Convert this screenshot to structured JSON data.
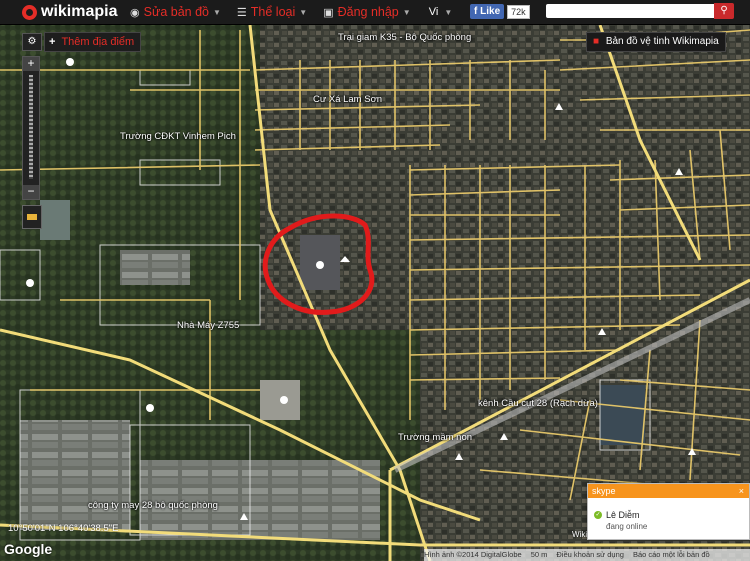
{
  "topbar": {
    "logo": "wikimapia",
    "menu": [
      {
        "icon": "globe-icon",
        "label": "Sửa bản đồ"
      },
      {
        "icon": "categories-icon",
        "label": "Thể loại"
      },
      {
        "icon": "login-icon",
        "label": "Đăng nhập"
      }
    ],
    "language": "Vi",
    "facebook": {
      "like_label": "Like",
      "count": "72k"
    },
    "search": {
      "placeholder": ""
    }
  },
  "controls": {
    "add_place": "Thêm địa điểm",
    "satellite_map": "Bản đồ vệ tinh Wikimapia"
  },
  "map_labels": [
    "Trại giam K35 - Bộ Quốc phòng",
    "Cư Xá Lam Sơn",
    "Trường CĐKT Vinhem Pich",
    "Nhà Máy Z755",
    "kênh Cầu cụt 28 (Rạch dừa)",
    "Trường mầm non",
    "công ty may 28 bộ quốc phòng"
  ],
  "coordinates": "10°50'01\"N 106°40'38.5\"E",
  "attribution": {
    "wikimapia": "Wikimapia CC BY-SA",
    "imagery": "Hình ảnh ©2014 DigitalGlobe",
    "scale": "50 m",
    "terms": "Điều khoản sử dụng",
    "report": "Báo cáo một lỗi bản đồ",
    "google": "Google"
  },
  "skype": {
    "header": "skype",
    "contact_name": "Lê Diễm",
    "status": "đang online"
  },
  "colors": {
    "accent": "#e52d27",
    "road": "#e8c96a",
    "skype": "#f7941d"
  }
}
